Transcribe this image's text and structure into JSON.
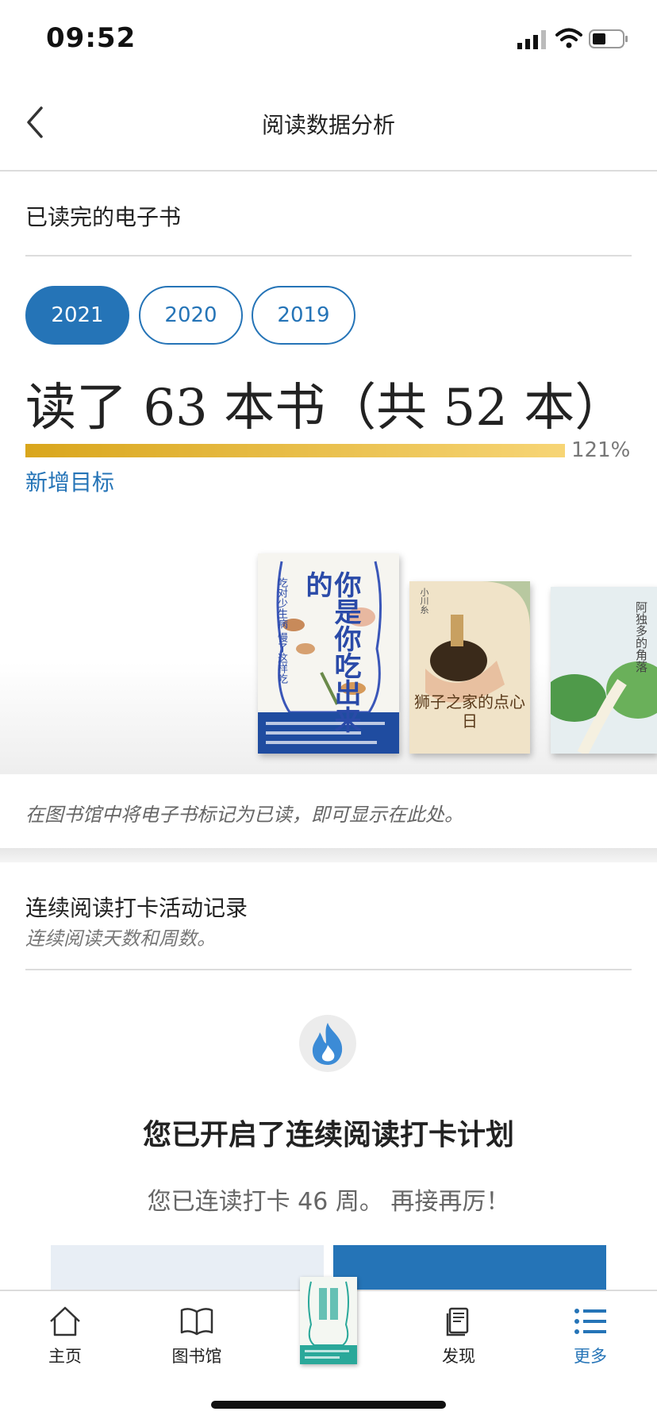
{
  "status_bar": {
    "time": "09:52"
  },
  "nav": {
    "title": "阅读数据分析"
  },
  "finished_books": {
    "section_title": "已读完的电子书",
    "years": [
      "2021",
      "2020",
      "2019"
    ],
    "selected_year": "2021",
    "headline": "读了 63 本书（共 52 本）",
    "progress_percent": 121,
    "progress_label": "121%",
    "add_goal_label": "新增目标",
    "books": [
      {
        "title": "你是你吃出来的",
        "subtitle": "吃对少生病 慢了这样吃"
      },
      {
        "title": "狮子之家的点心日",
        "author": "小川糸"
      },
      {
        "title": "阿独多的角落"
      }
    ],
    "note": "在图书馆中将电子书标记为已读，即可显示在此处。"
  },
  "streak": {
    "section_title": "连续阅读打卡活动记录",
    "section_subtitle": "连续阅读天数和周数。",
    "icon": "flame-icon",
    "plan_title": "您已开启了连续阅读打卡计划",
    "plan_subtitle": "您已连读打卡 46 周。 再接再厉！"
  },
  "tabbar": {
    "items": [
      {
        "label": "主页",
        "icon": "home-icon"
      },
      {
        "label": "图书馆",
        "icon": "book-open-icon"
      },
      {
        "label": "",
        "icon": "current-book-cover"
      },
      {
        "label": "发现",
        "icon": "discover-icon"
      },
      {
        "label": "更多",
        "icon": "list-icon"
      }
    ],
    "active": "更多"
  },
  "colors": {
    "accent": "#2574b7",
    "progress_start": "#d9a61c",
    "progress_end": "#f7d575"
  }
}
